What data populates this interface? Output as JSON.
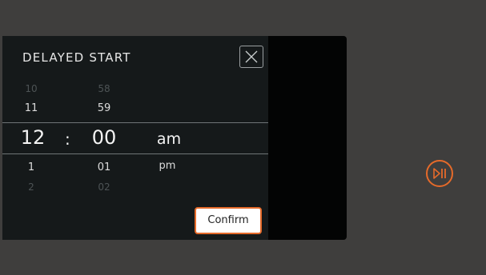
{
  "dialog": {
    "title": "DELAYED START",
    "confirm_label": "Confirm"
  },
  "picker": {
    "hours": {
      "far_above": "10",
      "above": "11",
      "selected": "12",
      "below": "1",
      "far_below": "2"
    },
    "separator": ":",
    "minutes": {
      "far_above": "58",
      "above": "59",
      "selected": "00",
      "below": "01",
      "far_below": "02"
    },
    "period": {
      "selected": "am",
      "below": "pm"
    }
  },
  "colors": {
    "accent": "#e56a2a",
    "background": "#3f3e3d",
    "dialog": "#15191a"
  },
  "icons": {
    "close": "close-icon",
    "play_pause": "play-pause-icon"
  }
}
